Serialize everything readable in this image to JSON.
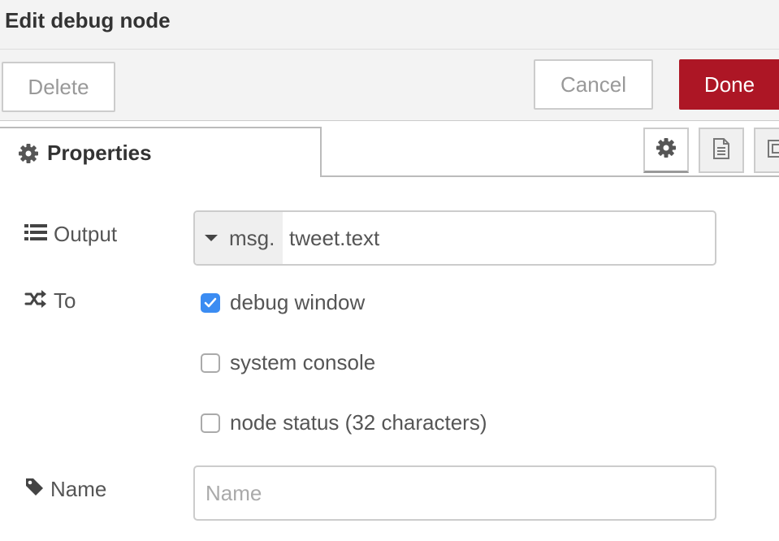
{
  "dialog": {
    "title": "Edit debug node"
  },
  "toolbar": {
    "delete_label": "Delete",
    "cancel_label": "Cancel",
    "done_label": "Done"
  },
  "tabs": [
    {
      "label": "Properties",
      "icon": "gear-icon",
      "active": true
    }
  ],
  "side_buttons": [
    "gear-icon",
    "document-icon",
    "frame-icon"
  ],
  "form": {
    "output": {
      "label": "Output",
      "type_prefix": "msg.",
      "value": "tweet.text"
    },
    "to": {
      "label": "To",
      "options": [
        {
          "label": "debug window",
          "checked": true
        },
        {
          "label": "system console",
          "checked": false
        },
        {
          "label": "node status (32 characters)",
          "checked": false
        }
      ]
    },
    "name": {
      "label": "Name",
      "value": "",
      "placeholder": "Name"
    }
  },
  "colors": {
    "accent": "#ad1625",
    "checkbox_checked": "#3b8cf2"
  }
}
